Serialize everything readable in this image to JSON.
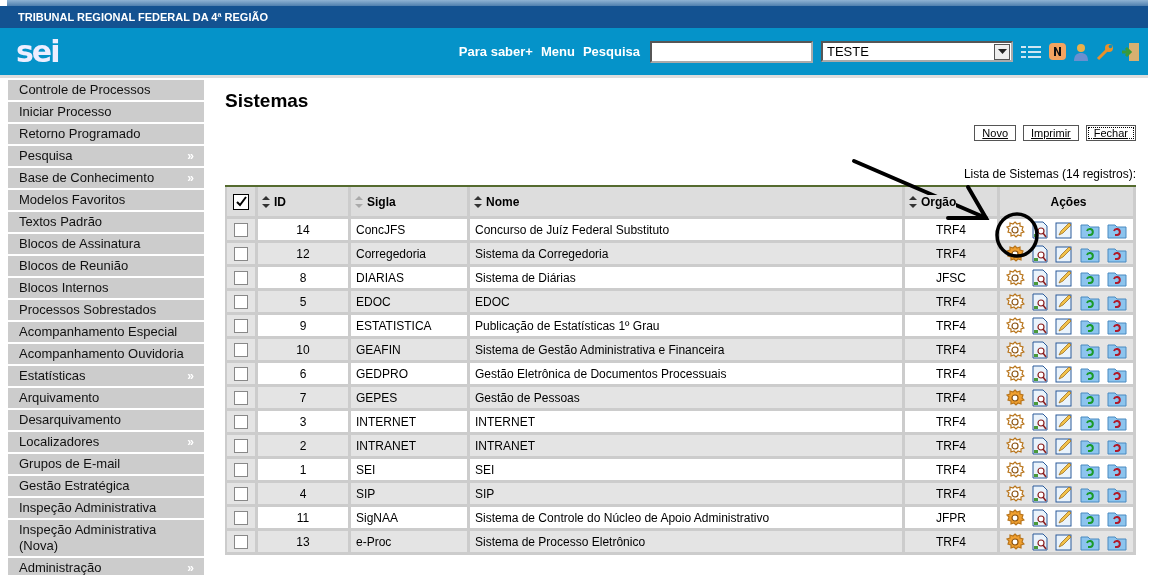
{
  "header": {
    "organization": "TRIBUNAL REGIONAL FEDERAL DA 4ª REGIÃO",
    "logo": "sei",
    "nav": [
      "Para saber+",
      "Menu",
      "Pesquisa"
    ],
    "unit_select": {
      "value": "TESTE"
    }
  },
  "sidebar": {
    "items": [
      {
        "label": "Controle de Processos"
      },
      {
        "label": "Iniciar Processo"
      },
      {
        "label": "Retorno Programado"
      },
      {
        "label": "Pesquisa",
        "marker": "»"
      },
      {
        "label": "Base de Conhecimento",
        "marker": "»"
      },
      {
        "label": "Modelos Favoritos"
      },
      {
        "label": "Textos Padrão"
      },
      {
        "label": "Blocos de Assinatura"
      },
      {
        "label": "Blocos de Reunião"
      },
      {
        "label": "Blocos Internos"
      },
      {
        "label": "Processos Sobrestados"
      },
      {
        "label": "Acompanhamento Especial"
      },
      {
        "label": "Acompanhamento Ouvidoria"
      },
      {
        "label": "Estatísticas",
        "marker": "»"
      },
      {
        "label": "Arquivamento"
      },
      {
        "label": "Desarquivamento"
      },
      {
        "label": "Localizadores",
        "marker": "»"
      },
      {
        "label": "Grupos de E-mail"
      },
      {
        "label": "Gestão Estratégica"
      },
      {
        "label": "Inspeção Administrativa"
      },
      {
        "label": "Inspeção Administrativa (Nova)"
      },
      {
        "label": "Administração",
        "marker": "»"
      }
    ]
  },
  "page": {
    "title": "Sistemas",
    "buttons": [
      {
        "label": "Novo",
        "focused": false
      },
      {
        "label": "Imprimir",
        "focused": false
      },
      {
        "label": "Fechar",
        "focused": true
      }
    ],
    "caption": "Lista de Sistemas (14 registros):",
    "table": {
      "select_all": {
        "checked": true
      },
      "columns": [
        "ID",
        "Sigla",
        "Nome",
        "Orgão",
        "Ações"
      ],
      "rows": [
        {
          "id": "14",
          "sigla": "ConcJFS",
          "nome": "Concurso de Juíz Federal Substituto",
          "orgao": "TRF4",
          "checked": false,
          "gear_filled": false
        },
        {
          "id": "12",
          "sigla": "Corregedoria",
          "nome": "Sistema da Corregedoria",
          "orgao": "TRF4",
          "checked": false,
          "gear_filled": true
        },
        {
          "id": "8",
          "sigla": "DIARIAS",
          "nome": "Sistema de Diárias",
          "orgao": "JFSC",
          "checked": false,
          "gear_filled": false
        },
        {
          "id": "5",
          "sigla": "EDOC",
          "nome": "EDOC",
          "orgao": "TRF4",
          "checked": false,
          "gear_filled": false
        },
        {
          "id": "9",
          "sigla": "ESTATISTICA",
          "nome": "Publicação de Estatísticas 1º Grau",
          "orgao": "TRF4",
          "checked": false,
          "gear_filled": false
        },
        {
          "id": "10",
          "sigla": "GEAFIN",
          "nome": "Sistema de Gestão Administrativa e Financeira",
          "orgao": "TRF4",
          "checked": false,
          "gear_filled": false
        },
        {
          "id": "6",
          "sigla": "GEDPRO",
          "nome": "Gestão Eletrônica de Documentos Processuais",
          "orgao": "TRF4",
          "checked": false,
          "gear_filled": false
        },
        {
          "id": "7",
          "sigla": "GEPES",
          "nome": "Gestão de Pessoas",
          "orgao": "TRF4",
          "checked": false,
          "gear_filled": true
        },
        {
          "id": "3",
          "sigla": "INTERNET",
          "nome": "INTERNET",
          "orgao": "TRF4",
          "checked": false,
          "gear_filled": false
        },
        {
          "id": "2",
          "sigla": "INTRANET",
          "nome": "INTRANET",
          "orgao": "TRF4",
          "checked": false,
          "gear_filled": false
        },
        {
          "id": "1",
          "sigla": "SEI",
          "nome": "SEI",
          "orgao": "TRF4",
          "checked": false,
          "gear_filled": false
        },
        {
          "id": "4",
          "sigla": "SIP",
          "nome": "SIP",
          "orgao": "TRF4",
          "checked": false,
          "gear_filled": false
        },
        {
          "id": "11",
          "sigla": "SigNAA",
          "nome": "Sistema de Controle do Núcleo de Apoio Administrativo",
          "orgao": "JFPR",
          "checked": false,
          "gear_filled": true
        },
        {
          "id": "13",
          "sigla": "e-Proc",
          "nome": "Sistema de Processo Eletrônico",
          "orgao": "TRF4",
          "checked": false,
          "gear_filled": true
        }
      ]
    }
  }
}
